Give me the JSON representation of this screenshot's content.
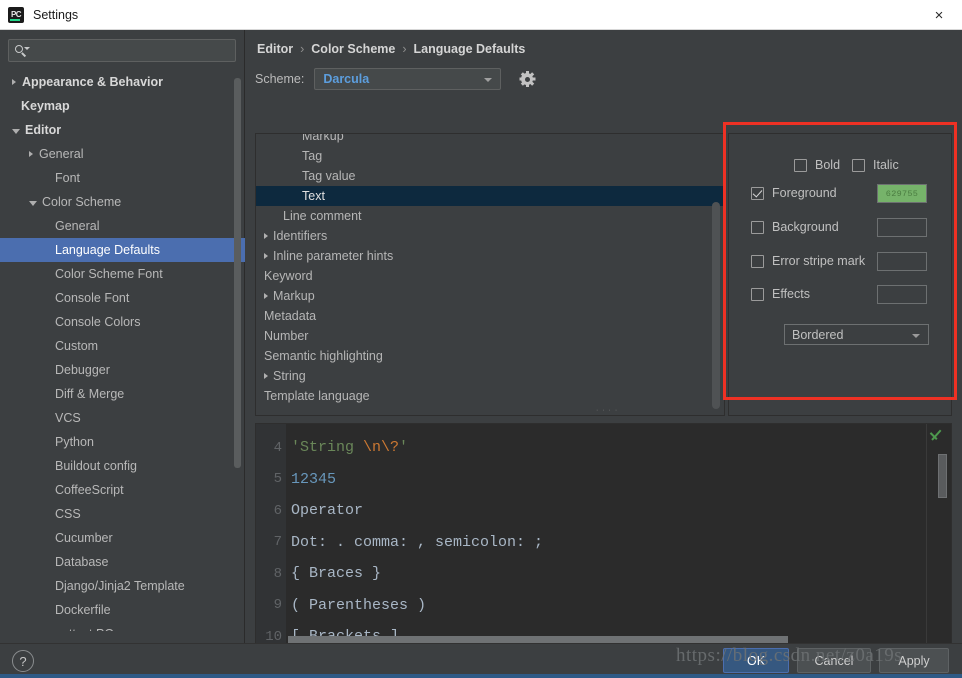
{
  "window": {
    "title": "Settings",
    "icon": "pycharm-icon",
    "close_label": "×"
  },
  "sidebar": {
    "search": {
      "placeholder": "",
      "value": "",
      "icon": "search-icon"
    },
    "items": [
      {
        "label": "Appearance & Behavior",
        "indent": 0,
        "twisty": "collapsed",
        "bold": true,
        "selected": false
      },
      {
        "label": "Keymap",
        "indent": 0,
        "twisty": "none",
        "bold": true,
        "selected": false
      },
      {
        "label": "Editor",
        "indent": 0,
        "twisty": "expanded",
        "bold": true,
        "selected": false
      },
      {
        "label": "General",
        "indent": 1,
        "twisty": "collapsed",
        "bold": false,
        "selected": false
      },
      {
        "label": "Font",
        "indent": 2,
        "twisty": "none",
        "bold": false,
        "selected": false
      },
      {
        "label": "Color Scheme",
        "indent": 1,
        "twisty": "expanded",
        "bold": false,
        "selected": false
      },
      {
        "label": "General",
        "indent": 2,
        "twisty": "none",
        "bold": false,
        "selected": false
      },
      {
        "label": "Language Defaults",
        "indent": 2,
        "twisty": "none",
        "bold": false,
        "selected": true
      },
      {
        "label": "Color Scheme Font",
        "indent": 2,
        "twisty": "none",
        "bold": false,
        "selected": false
      },
      {
        "label": "Console Font",
        "indent": 2,
        "twisty": "none",
        "bold": false,
        "selected": false
      },
      {
        "label": "Console Colors",
        "indent": 2,
        "twisty": "none",
        "bold": false,
        "selected": false
      },
      {
        "label": "Custom",
        "indent": 2,
        "twisty": "none",
        "bold": false,
        "selected": false
      },
      {
        "label": "Debugger",
        "indent": 2,
        "twisty": "none",
        "bold": false,
        "selected": false
      },
      {
        "label": "Diff & Merge",
        "indent": 2,
        "twisty": "none",
        "bold": false,
        "selected": false
      },
      {
        "label": "VCS",
        "indent": 2,
        "twisty": "none",
        "bold": false,
        "selected": false
      },
      {
        "label": "Python",
        "indent": 2,
        "twisty": "none",
        "bold": false,
        "selected": false
      },
      {
        "label": "Buildout config",
        "indent": 2,
        "twisty": "none",
        "bold": false,
        "selected": false
      },
      {
        "label": "CoffeeScript",
        "indent": 2,
        "twisty": "none",
        "bold": false,
        "selected": false
      },
      {
        "label": "CSS",
        "indent": 2,
        "twisty": "none",
        "bold": false,
        "selected": false
      },
      {
        "label": "Cucumber",
        "indent": 2,
        "twisty": "none",
        "bold": false,
        "selected": false
      },
      {
        "label": "Database",
        "indent": 2,
        "twisty": "none",
        "bold": false,
        "selected": false
      },
      {
        "label": "Django/Jinja2 Template",
        "indent": 2,
        "twisty": "none",
        "bold": false,
        "selected": false
      },
      {
        "label": "Dockerfile",
        "indent": 2,
        "twisty": "none",
        "bold": false,
        "selected": false
      },
      {
        "label": "gettext PO",
        "indent": 2,
        "twisty": "none",
        "bold": false,
        "selected": false
      }
    ]
  },
  "main": {
    "breadcrumb": {
      "parts": [
        "Editor",
        "Color Scheme",
        "Language Defaults"
      ],
      "separator": "›"
    },
    "scheme": {
      "label": "Scheme:",
      "value": "Darcula",
      "gear_icon": "gear-icon"
    },
    "options": [
      {
        "label": "Markup",
        "indent": 2,
        "twisty": "none",
        "selected": false
      },
      {
        "label": "Tag",
        "indent": 2,
        "twisty": "none",
        "selected": false
      },
      {
        "label": "Tag value",
        "indent": 2,
        "twisty": "none",
        "selected": false
      },
      {
        "label": "Text",
        "indent": 2,
        "twisty": "none",
        "selected": true
      },
      {
        "label": "Line comment",
        "indent": 1,
        "twisty": "none",
        "selected": false
      },
      {
        "label": "Identifiers",
        "indent": 0,
        "twisty": "collapsed",
        "selected": false
      },
      {
        "label": "Inline parameter hints",
        "indent": 0,
        "twisty": "collapsed",
        "selected": false
      },
      {
        "label": "Keyword",
        "indent": 0,
        "twisty": "none",
        "selected": false
      },
      {
        "label": "Markup",
        "indent": 0,
        "twisty": "collapsed",
        "selected": false
      },
      {
        "label": "Metadata",
        "indent": 0,
        "twisty": "none",
        "selected": false
      },
      {
        "label": "Number",
        "indent": 0,
        "twisty": "none",
        "selected": false
      },
      {
        "label": "Semantic highlighting",
        "indent": 0,
        "twisty": "none",
        "selected": false
      },
      {
        "label": "String",
        "indent": 0,
        "twisty": "collapsed",
        "selected": false
      },
      {
        "label": "Template language",
        "indent": 0,
        "twisty": "none",
        "selected": false
      }
    ],
    "attributes": {
      "bold": {
        "label": "Bold",
        "checked": false
      },
      "italic": {
        "label": "Italic",
        "checked": false
      },
      "foreground": {
        "label": "Foreground",
        "checked": true,
        "color": "#76b36a",
        "hex": "629755"
      },
      "background": {
        "label": "Background",
        "checked": false,
        "color": ""
      },
      "error_stripe_mark": {
        "label": "Error stripe mark",
        "checked": false,
        "color": ""
      },
      "effects": {
        "label": "Effects",
        "checked": false,
        "color": ""
      },
      "effects_type": {
        "value": "Bordered"
      }
    }
  },
  "preview": {
    "lines": [
      {
        "no": "4",
        "segments": [
          {
            "text": "'String ",
            "style": "s-string"
          },
          {
            "text": "\\n",
            "style": "s-esc"
          },
          {
            "text": "\\?",
            "style": "s-esc-bad"
          },
          {
            "text": "'",
            "style": "s-string"
          }
        ]
      },
      {
        "no": "5",
        "segments": [
          {
            "text": "12345",
            "style": "s-num"
          }
        ]
      },
      {
        "no": "6",
        "segments": [
          {
            "text": "Operator",
            "style": "s-default"
          }
        ]
      },
      {
        "no": "7",
        "segments": [
          {
            "text": "Dot: . comma: , semicolon: ;",
            "style": "s-default"
          }
        ]
      },
      {
        "no": "8",
        "segments": [
          {
            "text": "{ Braces }",
            "style": "s-default"
          }
        ]
      },
      {
        "no": "9",
        "segments": [
          {
            "text": "( Parentheses )",
            "style": "s-default"
          }
        ]
      },
      {
        "no": "10",
        "segments": [
          {
            "text": "[ Brackets ]",
            "style": "s-default"
          }
        ]
      }
    ],
    "inspection_icon": "green-check-icon"
  },
  "footer": {
    "help_label": "?",
    "ok_label": "OK",
    "cancel_label": "Cancel",
    "apply_label": "Apply"
  },
  "watermark": {
    "text": "https://blog.csdn.net/z0a19s"
  }
}
